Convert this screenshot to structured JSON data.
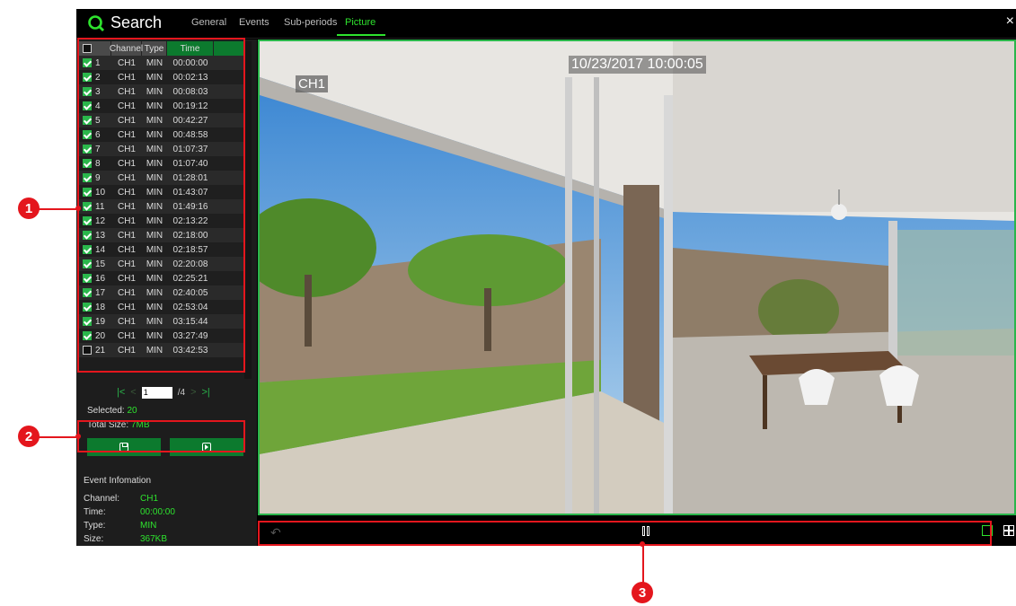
{
  "header": {
    "title": "Search",
    "tabs": [
      {
        "label": "General",
        "active": false
      },
      {
        "label": "Events",
        "active": false
      },
      {
        "label": "Sub-periods",
        "active": false
      },
      {
        "label": "Picture",
        "active": true
      }
    ],
    "close": "×"
  },
  "table": {
    "columns": [
      "Channel",
      "Type",
      "Time"
    ],
    "rows": [
      {
        "num": "1",
        "channel": "CH1",
        "type": "MIN",
        "time": "00:00:00",
        "checked": true
      },
      {
        "num": "2",
        "channel": "CH1",
        "type": "MIN",
        "time": "00:02:13",
        "checked": true
      },
      {
        "num": "3",
        "channel": "CH1",
        "type": "MIN",
        "time": "00:08:03",
        "checked": true
      },
      {
        "num": "4",
        "channel": "CH1",
        "type": "MIN",
        "time": "00:19:12",
        "checked": true
      },
      {
        "num": "5",
        "channel": "CH1",
        "type": "MIN",
        "time": "00:42:27",
        "checked": true
      },
      {
        "num": "6",
        "channel": "CH1",
        "type": "MIN",
        "time": "00:48:58",
        "checked": true
      },
      {
        "num": "7",
        "channel": "CH1",
        "type": "MIN",
        "time": "01:07:37",
        "checked": true
      },
      {
        "num": "8",
        "channel": "CH1",
        "type": "MIN",
        "time": "01:07:40",
        "checked": true
      },
      {
        "num": "9",
        "channel": "CH1",
        "type": "MIN",
        "time": "01:28:01",
        "checked": true
      },
      {
        "num": "10",
        "channel": "CH1",
        "type": "MIN",
        "time": "01:43:07",
        "checked": true
      },
      {
        "num": "11",
        "channel": "CH1",
        "type": "MIN",
        "time": "01:49:16",
        "checked": true
      },
      {
        "num": "12",
        "channel": "CH1",
        "type": "MIN",
        "time": "02:13:22",
        "checked": true
      },
      {
        "num": "13",
        "channel": "CH1",
        "type": "MIN",
        "time": "02:18:00",
        "checked": true
      },
      {
        "num": "14",
        "channel": "CH1",
        "type": "MIN",
        "time": "02:18:57",
        "checked": true
      },
      {
        "num": "15",
        "channel": "CH1",
        "type": "MIN",
        "time": "02:20:08",
        "checked": true
      },
      {
        "num": "16",
        "channel": "CH1",
        "type": "MIN",
        "time": "02:25:21",
        "checked": true
      },
      {
        "num": "17",
        "channel": "CH1",
        "type": "MIN",
        "time": "02:40:05",
        "checked": true
      },
      {
        "num": "18",
        "channel": "CH1",
        "type": "MIN",
        "time": "02:53:04",
        "checked": true
      },
      {
        "num": "19",
        "channel": "CH1",
        "type": "MIN",
        "time": "03:15:44",
        "checked": true
      },
      {
        "num": "20",
        "channel": "CH1",
        "type": "MIN",
        "time": "03:27:49",
        "checked": true
      },
      {
        "num": "21",
        "channel": "CH1",
        "type": "MIN",
        "time": "03:42:53",
        "checked": false
      }
    ]
  },
  "pager": {
    "current": "1",
    "total": "/4"
  },
  "summary": {
    "selected_label": "Selected:",
    "selected_value": "20",
    "total_label": "Total Size:",
    "total_value": "7MB"
  },
  "event": {
    "title": "Event Infomation",
    "fields": [
      {
        "label": "Channel:",
        "value": "CH1"
      },
      {
        "label": "Time:",
        "value": "00:00:00"
      },
      {
        "label": "Type:",
        "value": "MIN"
      },
      {
        "label": "Size:",
        "value": "367KB"
      }
    ]
  },
  "video": {
    "timestamp": "10/23/2017 10:00:05",
    "channel": "CH1"
  },
  "callouts": [
    "1",
    "2",
    "3"
  ],
  "colors": {
    "accent": "#2ee32e",
    "button": "#0c7a2e",
    "callout": "#e4161d"
  }
}
